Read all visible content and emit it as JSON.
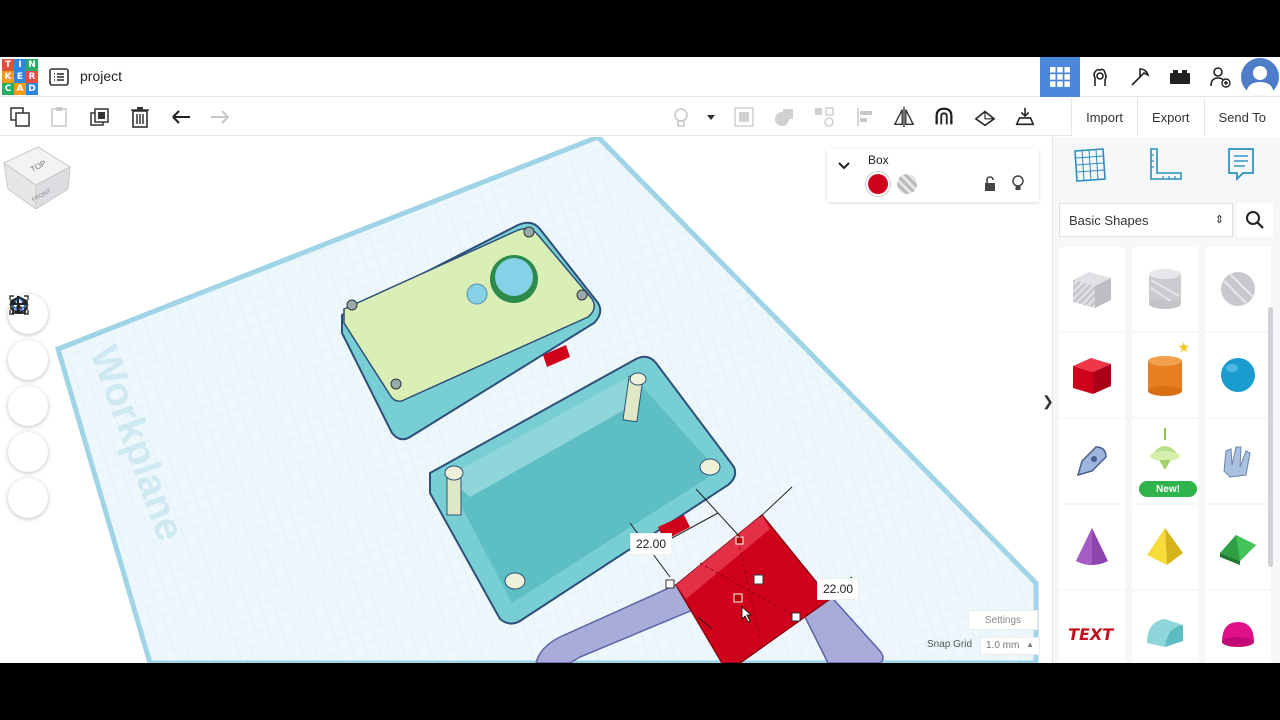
{
  "app": {
    "project_name": "project",
    "logo_letters": [
      "T",
      "I",
      "N",
      "K",
      "E",
      "R",
      "C",
      "A",
      "D"
    ],
    "logo_colors": [
      "#e74c3c",
      "#2e86de",
      "#27ae60",
      "#f39c12",
      "#2e86de",
      "#e74c3c",
      "#27ae60",
      "#f39c12",
      "#2e86de"
    ]
  },
  "topbar": {
    "icons": [
      "3d-design-grid-icon",
      "circuits-icon",
      "codeblocks-icon",
      "lego-brick-icon",
      "add-user-icon"
    ],
    "active": "3d-design-grid-icon"
  },
  "toolbar": {
    "left_icons": [
      "copy-icon",
      "paste-icon",
      "duplicate-icon",
      "delete-icon",
      "undo-icon",
      "redo-icon"
    ],
    "right_icons": [
      "light-bulb-icon",
      "dropdown-icon",
      "group-icon",
      "solid-icon",
      "align-icon",
      "flip-icon",
      "magnet-icon",
      "cruise-icon",
      "drop-icon"
    ],
    "import_label": "Import",
    "export_label": "Export",
    "sendto_label": "Send To"
  },
  "viewcube": {
    "top_label": "TOP",
    "front_label": "FRONT"
  },
  "workplane_label": "Workplane",
  "inspector": {
    "title": "Box",
    "colors": {
      "solid": "#d0021b",
      "hole": "hole-striped"
    }
  },
  "dimensions": {
    "width": "22.00",
    "length": "22.00"
  },
  "settings": {
    "settings_label": "Settings",
    "snap_label": "Snap Grid",
    "snap_value": "1.0 mm"
  },
  "shapes_panel": {
    "category": "Basic Shapes",
    "new_badge": "New!",
    "items": [
      "box-hole",
      "cylinder-hole",
      "sphere-hole",
      "box",
      "cylinder",
      "sphere",
      "scribble",
      "new-shape",
      "text-hand",
      "cone",
      "pyramid",
      "roof",
      "text",
      "half-cylinder",
      "paraboloid"
    ]
  },
  "colors": {
    "accent": "#4a86d9",
    "workplane_line": "#9fd3e6",
    "selected_red": "#d0021b"
  }
}
